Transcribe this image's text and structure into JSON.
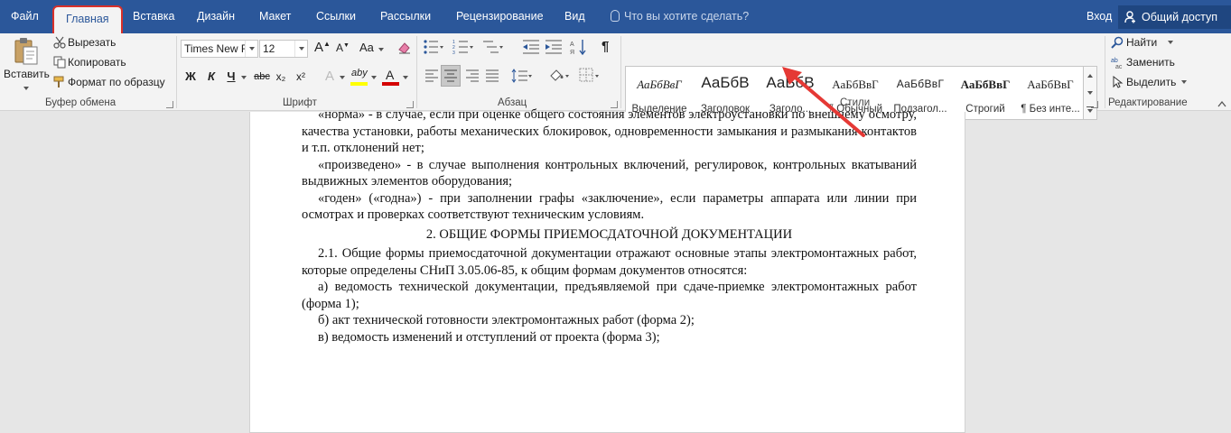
{
  "tabs": [
    {
      "label": "Файл"
    },
    {
      "label": "Главная"
    },
    {
      "label": "Вставка"
    },
    {
      "label": "Дизайн"
    },
    {
      "label": "Макет"
    },
    {
      "label": "Ссылки"
    },
    {
      "label": "Рассылки"
    },
    {
      "label": "Рецензирование"
    },
    {
      "label": "Вид"
    }
  ],
  "tell_me": "Что вы хотите сделать?",
  "login": "Вход",
  "share": "Общий доступ",
  "clipboard": {
    "paste": "Вставить",
    "cut": "Вырезать",
    "copy": "Копировать",
    "format_painter": "Формат по образцу",
    "label": "Буфер обмена"
  },
  "font": {
    "name": "Times New R",
    "size": "12",
    "label": "Шрифт",
    "grow": "A",
    "shrink": "A",
    "case": "Aa",
    "bold": "Ж",
    "italic": "К",
    "underline": "Ч",
    "strike": "abc",
    "sub": "x₂",
    "sup": "x²",
    "effects": "A",
    "highlight": "aby",
    "color": "A",
    "highlight_color": "#ffff00",
    "font_color": "#d40000"
  },
  "paragraph": {
    "label": "Абзац",
    "marks": "¶"
  },
  "styles": {
    "label": "Стили",
    "items": [
      {
        "sample": "АаБбВвГ",
        "name": "Выделение"
      },
      {
        "sample": "АаБбВ",
        "name": "Заголовок"
      },
      {
        "sample": "АаБбВ",
        "name": "Заголо..."
      },
      {
        "sample": "АаБбВвГ",
        "name": "¶ Обычный"
      },
      {
        "sample": "АаБбВвГ",
        "name": "Подзагол..."
      },
      {
        "sample": "АаБбВвГ",
        "name": "Строгий"
      },
      {
        "sample": "АаБбВвГ",
        "name": "¶ Без инте..."
      }
    ]
  },
  "editing": {
    "find": "Найти",
    "replace": "Заменить",
    "select": "Выделить",
    "label": "Редактирование"
  },
  "document": {
    "paragraphs": [
      "«норма» - в случае, если при оценке общего состояния элементов электроустановки по внешнему осмотру, качества установки, работы механических блокировок, одновременности замыкания и размыкания контактов и т.п. отклонений нет;",
      "«произведено» - в случае выполнения контрольных включений, регулировок, контрольных вкатываний выдвижных элементов оборудования;",
      "«годен» («годна») - при заполнении графы «заключение», если параметры аппарата или линии при осмотрах и проверках соответствуют техническим условиям."
    ],
    "heading": "2. ОБЩИЕ ФОРМЫ ПРИЕМОСДАТОЧНОЙ ДОКУМЕНТАЦИИ",
    "paragraphs2": [
      "2.1. Общие формы приемосдаточной документации отражают основные этапы электромонтажных работ, которые определены СНиП 3.05.06-85, к общим формам документов относятся:",
      "а) ведомость технической документации, предъявляемой при сдаче-приемке электромонтажных работ (форма 1);",
      "б) акт технической готовности электромонтажных работ (форма 2);",
      "в) ведомость изменений и отступлений от проекта (форма 3);"
    ]
  },
  "colors": {
    "accent": "#2b579a",
    "highlight_outline": "#d8302a",
    "arrow": "#e53935"
  }
}
